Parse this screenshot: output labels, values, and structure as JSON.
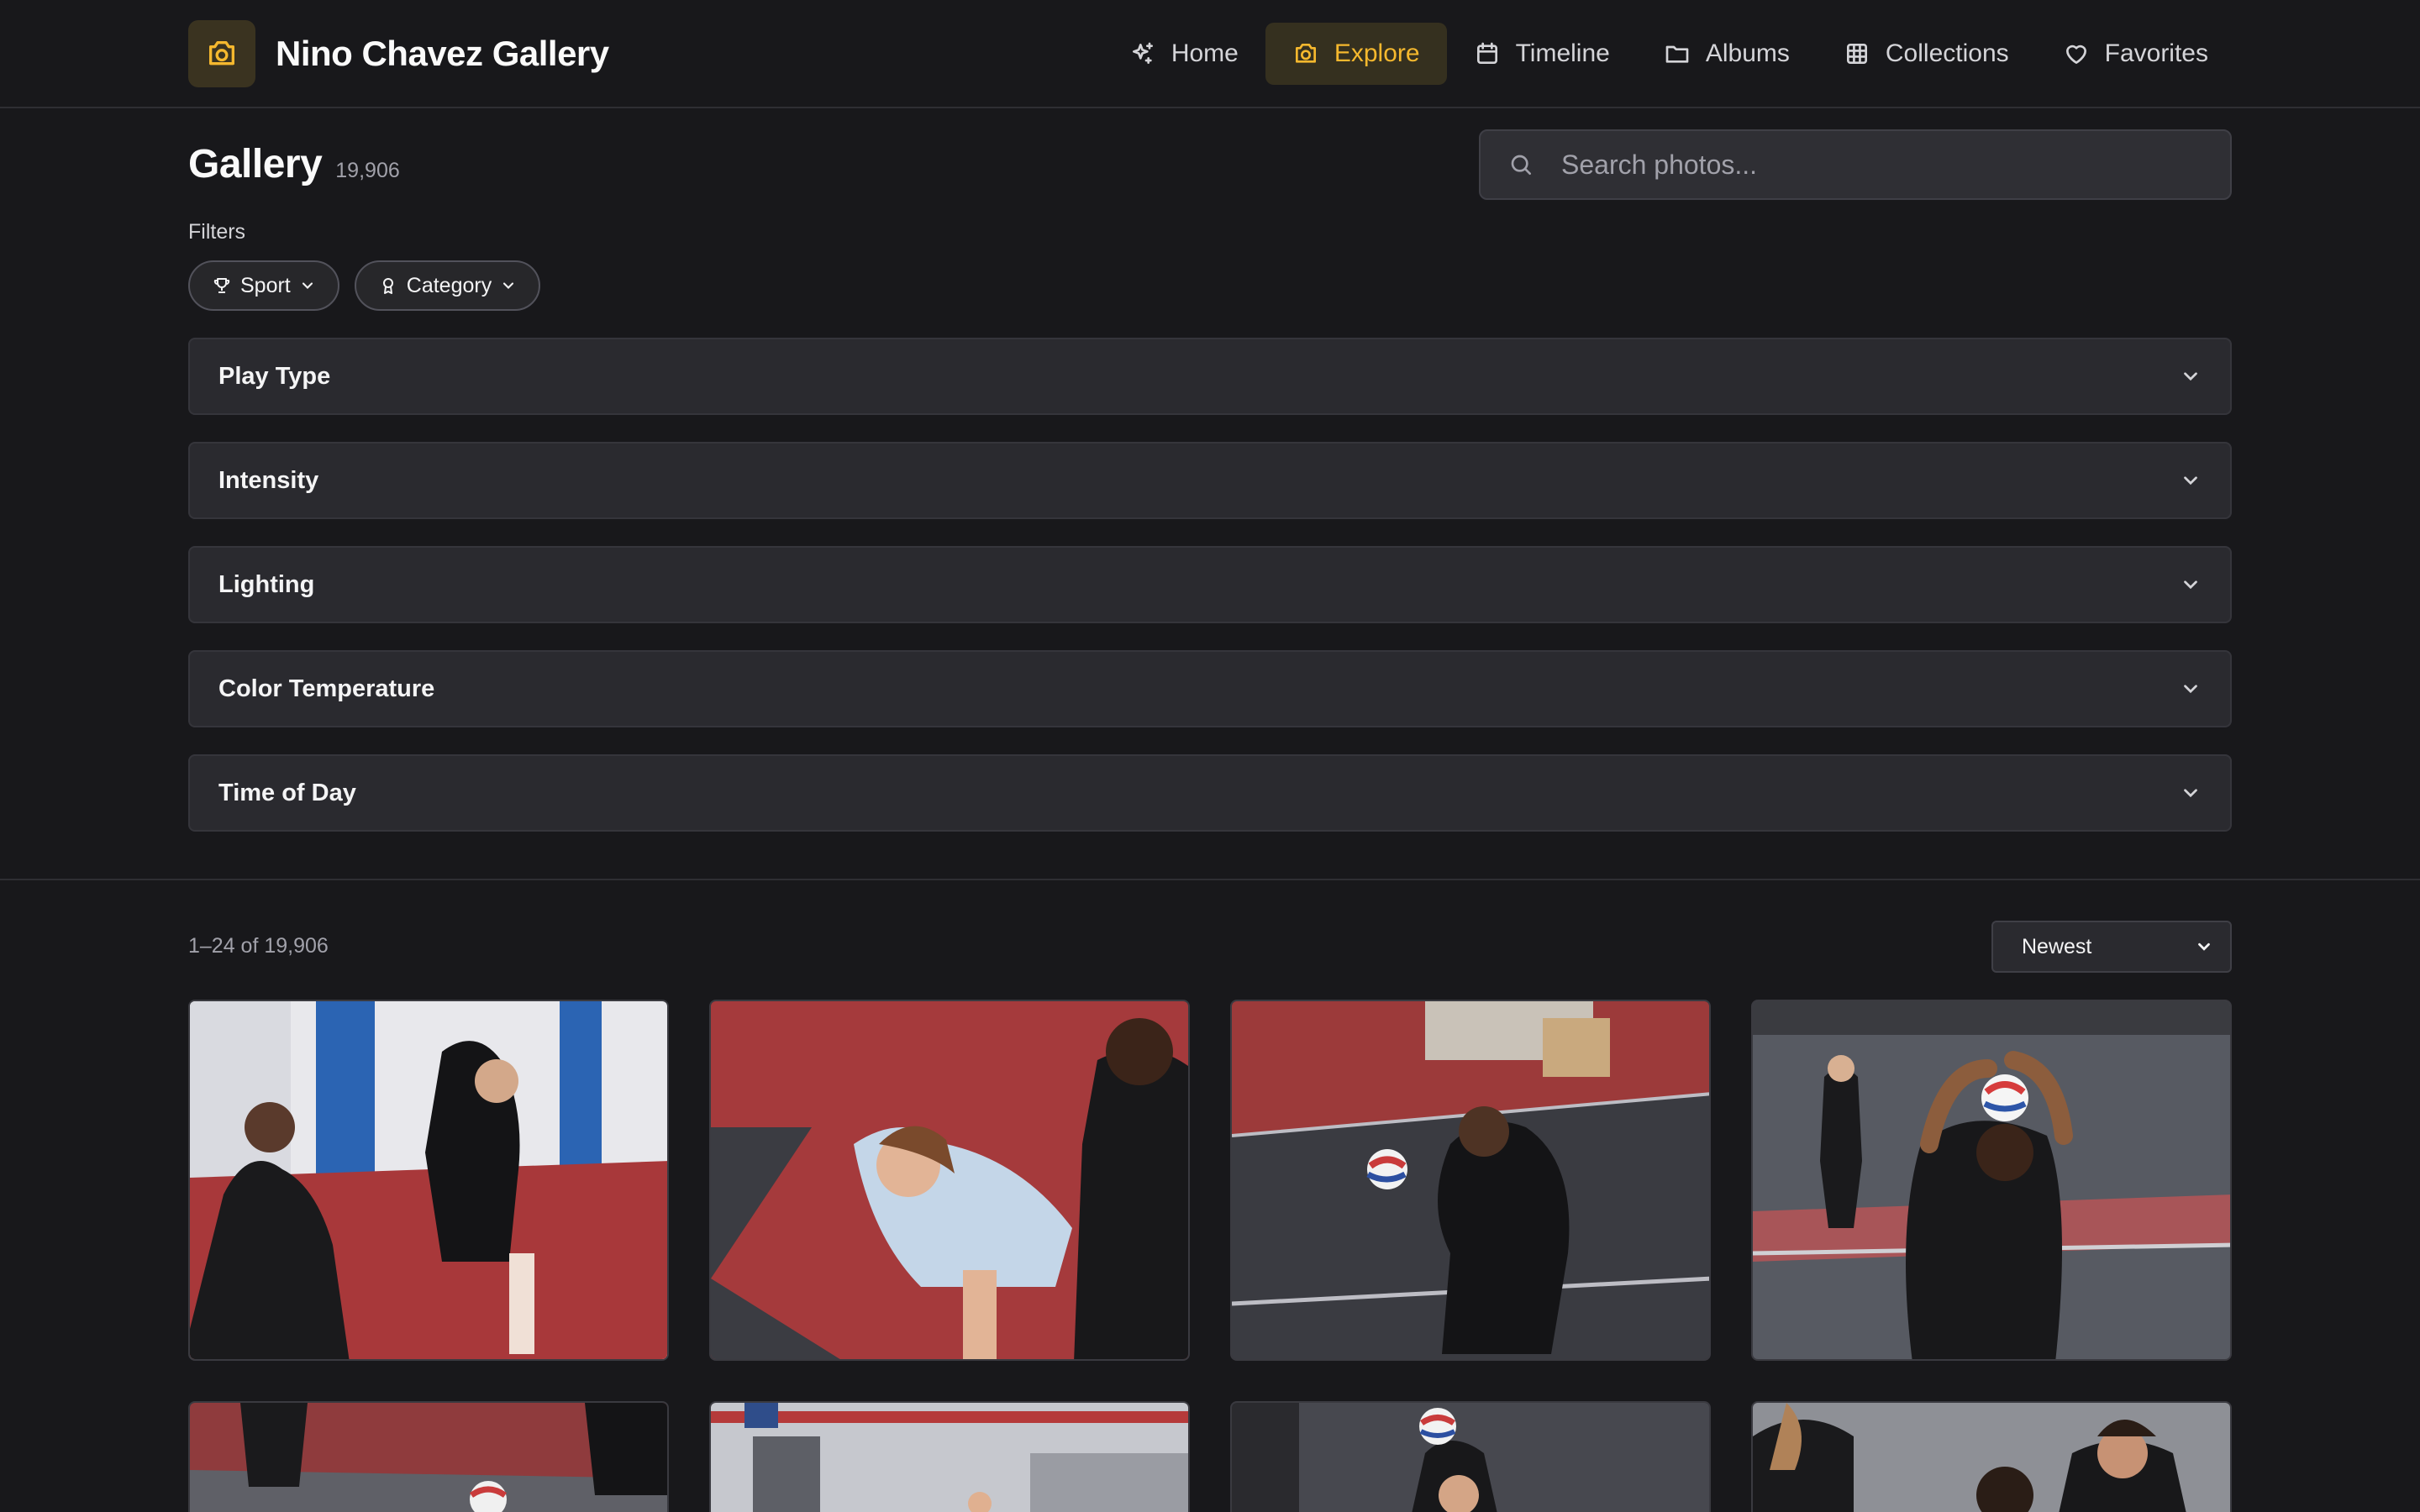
{
  "app": {
    "title": "Nino Chavez Gallery",
    "logo_icon": "camera-icon",
    "accent": "#f5b82e"
  },
  "nav": [
    {
      "label": "Home",
      "icon": "sparkle-icon",
      "active": false
    },
    {
      "label": "Explore",
      "icon": "camera-icon",
      "active": true
    },
    {
      "label": "Timeline",
      "icon": "calendar-icon",
      "active": false
    },
    {
      "label": "Albums",
      "icon": "folder-icon",
      "active": false
    },
    {
      "label": "Collections",
      "icon": "grid-icon",
      "active": false
    },
    {
      "label": "Favorites",
      "icon": "heart-icon",
      "active": false
    }
  ],
  "gallery": {
    "title": "Gallery",
    "count": "19,906"
  },
  "search": {
    "placeholder": "Search photos..."
  },
  "filters": {
    "label": "Filters",
    "chips": [
      {
        "label": "Sport",
        "icon": "trophy-icon"
      },
      {
        "label": "Category",
        "icon": "award-icon"
      }
    ],
    "sections": [
      "Play Type",
      "Intensity",
      "Lighting",
      "Color Temperature",
      "Time of Day"
    ]
  },
  "results": {
    "range": "1–24 of 19,906",
    "sort": "Newest"
  }
}
